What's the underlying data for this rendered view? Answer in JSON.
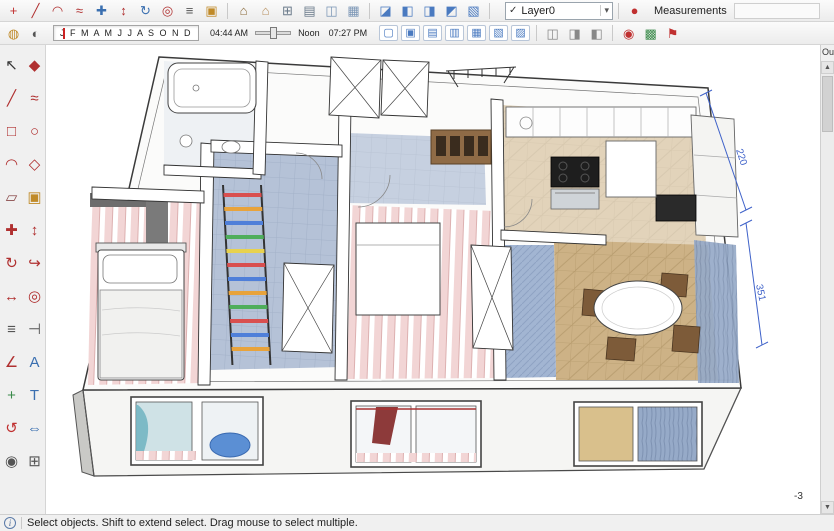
{
  "top_toolbar": {
    "icons": [
      {
        "name": "axes-icon",
        "glyph": "+",
        "color": "#c03030"
      },
      {
        "name": "line-tool-icon",
        "glyph": "╱",
        "color": "#b03030"
      },
      {
        "name": "arc-tool-icon",
        "glyph": "◠",
        "color": "#b03030"
      },
      {
        "name": "freehand-tool-icon",
        "glyph": "≈",
        "color": "#b03030"
      },
      {
        "name": "move-tool-icon",
        "glyph": "✚",
        "color": "#3a6fb0"
      },
      {
        "name": "push-pull-tool-icon",
        "glyph": "↕",
        "color": "#b03030"
      },
      {
        "name": "rotate-tool-icon",
        "glyph": "↻",
        "color": "#3a6fb0"
      },
      {
        "name": "offset-tool-icon",
        "glyph": "◎",
        "color": "#b03030"
      },
      {
        "name": "tape-measure-icon",
        "glyph": "≡",
        "color": "#555555"
      },
      {
        "name": "paint-bucket-icon",
        "glyph": "▣",
        "color": "#c08a28"
      },
      {
        "sep": true
      },
      {
        "name": "make-component-icon",
        "glyph": "⌂",
        "color": "#8a6a3a"
      },
      {
        "name": "component-browser-icon",
        "glyph": "⌂",
        "color": "#b8905f"
      },
      {
        "name": "group-icon",
        "glyph": "⊞",
        "color": "#6a7a8a"
      },
      {
        "name": "outliner-icon",
        "glyph": "▤",
        "color": "#6a7a8a"
      },
      {
        "name": "cabinet-component-icon",
        "glyph": "◫",
        "color": "#7a95b5"
      },
      {
        "name": "stairs-component-icon",
        "glyph": "▦",
        "color": "#7a95b5"
      },
      {
        "sep": true
      },
      {
        "name": "iso-view-icon",
        "glyph": "◪",
        "color": "#4a7ac0"
      },
      {
        "name": "top-view-icon",
        "glyph": "◧",
        "color": "#4a7ac0"
      },
      {
        "name": "front-view-icon",
        "glyph": "◨",
        "color": "#4a7ac0"
      },
      {
        "name": "back-view-icon",
        "glyph": "◩",
        "color": "#4a7ac0"
      },
      {
        "name": "side-view-icon",
        "glyph": "▧",
        "color": "#4a7ac0"
      },
      {
        "sep": true
      }
    ],
    "layer_selector": {
      "check": "✓",
      "value": "Layer0",
      "arrow": "▾"
    },
    "after_layer_icons": [
      {
        "sep": true
      },
      {
        "name": "autosave-indicator-icon",
        "glyph": "●",
        "color": "#c03030"
      }
    ],
    "measurements_label": "Measurements"
  },
  "shadow_toolbar": {
    "left_icons": [
      {
        "name": "styles-icon",
        "glyph": "◍",
        "color": "#c08a28"
      },
      {
        "name": "shadows-toggle-icon",
        "glyph": "◐",
        "color": "#555555"
      }
    ],
    "months": "J F M A M J J A S O N D",
    "time_start": "04:44 AM",
    "noon_label": "Noon",
    "time_end": "07:27 PM",
    "style_icons": [
      {
        "name": "xray-style-icon",
        "glyph": "▢",
        "color": "#4a7ac0",
        "cls": "cube"
      },
      {
        "name": "back-edges-style-icon",
        "glyph": "▣",
        "color": "#4a7ac0",
        "cls": "cube"
      },
      {
        "name": "wireframe-style-icon",
        "glyph": "▤",
        "color": "#4a7ac0",
        "cls": "cube"
      },
      {
        "name": "hidden-line-style-icon",
        "glyph": "▥",
        "color": "#4a7ac0",
        "cls": "cube"
      },
      {
        "name": "shaded-style-icon",
        "glyph": "▦",
        "color": "#4a7ac0",
        "cls": "cube"
      },
      {
        "name": "textured-style-icon",
        "glyph": "▧",
        "color": "#4a7ac0",
        "cls": "cube"
      },
      {
        "name": "monochrome-style-icon",
        "glyph": "▨",
        "color": "#4a7ac0",
        "cls": "cube"
      },
      {
        "sep": true
      },
      {
        "name": "section-plane-icon",
        "glyph": "◫",
        "color": "#888888"
      },
      {
        "name": "section-cuts-icon",
        "glyph": "◨",
        "color": "#888888"
      },
      {
        "name": "section-fill-icon",
        "glyph": "◧",
        "color": "#888888"
      },
      {
        "sep": true
      },
      {
        "name": "add-location-icon",
        "glyph": "◉",
        "color": "#c03030"
      },
      {
        "name": "photo-textures-icon",
        "glyph": "▩",
        "color": "#3a8a4a"
      },
      {
        "name": "position-camera-icon",
        "glyph": "⚑",
        "color": "#c03030"
      }
    ]
  },
  "left_toolbar": {
    "tools": [
      {
        "name": "select-tool-icon",
        "glyph": "↖",
        "color": "#333333"
      },
      {
        "name": "make-component-tool-icon",
        "glyph": "◆",
        "color": "#b03030"
      },
      {
        "name": "line-tool-icon",
        "glyph": "╱",
        "color": "#b03030"
      },
      {
        "name": "freehand-tool-icon",
        "glyph": "≈",
        "color": "#b03030"
      },
      {
        "name": "rectangle-tool-icon",
        "glyph": "□",
        "color": "#b03030"
      },
      {
        "name": "circle-tool-icon",
        "glyph": "○",
        "color": "#b03030"
      },
      {
        "name": "arc-tool-icon",
        "glyph": "◠",
        "color": "#b03030"
      },
      {
        "name": "polygon-tool-icon",
        "glyph": "◇",
        "color": "#b03030"
      },
      {
        "name": "eraser-tool-icon",
        "glyph": "▱",
        "color": "#8a4a4a"
      },
      {
        "name": "paint-bucket-tool-icon",
        "glyph": "▣",
        "color": "#c08a28"
      },
      {
        "name": "move-tool-icon",
        "glyph": "✚",
        "color": "#b03030"
      },
      {
        "name": "push-pull-tool-icon",
        "glyph": "↕",
        "color": "#b03030"
      },
      {
        "name": "rotate-tool-icon",
        "glyph": "↻",
        "color": "#b03030"
      },
      {
        "name": "follow-me-tool-icon",
        "glyph": "↪",
        "color": "#b03030"
      },
      {
        "name": "scale-tool-icon",
        "glyph": "↔",
        "color": "#b03030"
      },
      {
        "name": "offset-tool-icon",
        "glyph": "◎",
        "color": "#b03030"
      },
      {
        "name": "tape-measure-tool-icon",
        "glyph": "≡",
        "color": "#555555"
      },
      {
        "name": "dimension-tool-icon",
        "glyph": "⊣",
        "color": "#555555"
      },
      {
        "name": "protractor-tool-icon",
        "glyph": "∠",
        "color": "#b03030"
      },
      {
        "name": "text-tool-icon",
        "glyph": "A",
        "color": "#3a6fb0"
      },
      {
        "name": "axes-tool-icon",
        "glyph": "+",
        "color": "#3a8a4a"
      },
      {
        "name": "3d-text-tool-icon",
        "glyph": "T",
        "color": "#3a6fb0"
      },
      {
        "name": "orbit-tool-icon",
        "glyph": "↺",
        "color": "#c03030"
      },
      {
        "name": "pan-tool-icon",
        "glyph": "⇔",
        "color": "#3a6fb0"
      },
      {
        "name": "zoom-tool-icon",
        "glyph": "◉",
        "color": "#555555"
      },
      {
        "name": "zoom-extents-tool-icon",
        "glyph": "⊞",
        "color": "#555555"
      }
    ]
  },
  "right_panel": {
    "title": "Ou...",
    "up_arrow": "▲",
    "down_arrow": "▼"
  },
  "canvas": {
    "dim_220": "220",
    "dim_351": "351",
    "corner_value": "-3"
  },
  "status_bar": {
    "info_glyph": "i",
    "text": "Select objects. Shift to extend select. Drag mouse to select multiple."
  }
}
